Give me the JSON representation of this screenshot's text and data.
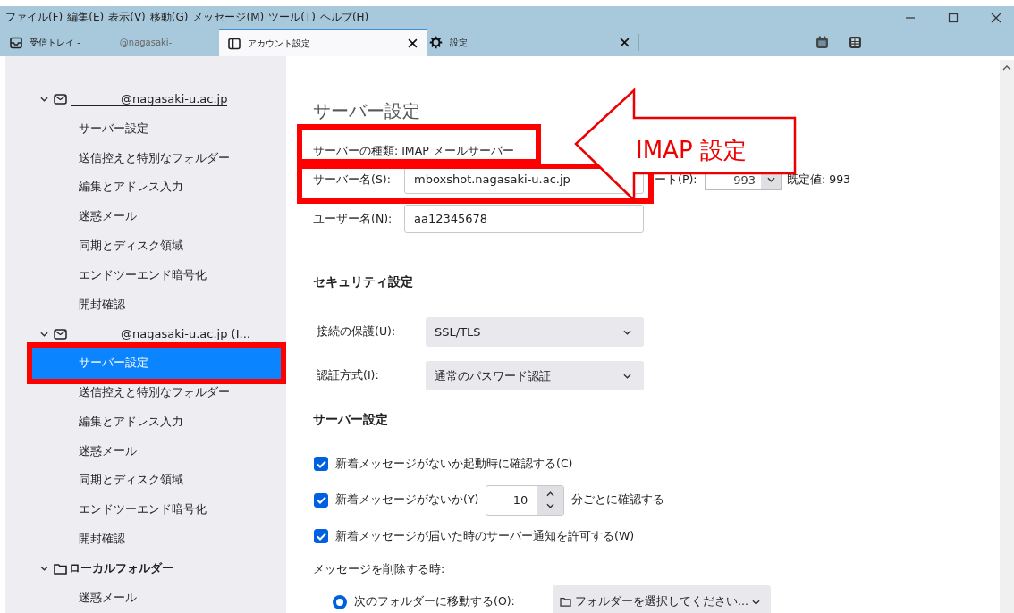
{
  "menu": [
    "ファイル(F)",
    "編集(E)",
    "表示(V)",
    "移動(G)",
    "メッセージ(M)",
    "ツール(T)",
    "ヘルプ(H)"
  ],
  "tabs": [
    {
      "kind": "mail",
      "label": "受信トレイ -",
      "sublabel": "@nagasaki-",
      "selected": false
    },
    {
      "kind": "account",
      "label": "アカウント設定",
      "selected": true,
      "closable": true
    },
    {
      "kind": "settings",
      "label": "設定",
      "selected": false,
      "closable": true
    }
  ],
  "sidebar": {
    "items": [
      {
        "kind": "account",
        "label": "@nagasaki-u.ac.jp",
        "underlined": true,
        "expanded": true,
        "children": [
          {
            "label": "サーバー設定",
            "selected": false
          },
          {
            "label": "送信控えと特別なフォルダー",
            "selected": false
          },
          {
            "label": "編集とアドレス入力",
            "selected": false
          },
          {
            "label": "迷惑メール",
            "selected": false
          },
          {
            "label": "同期とディスク領域",
            "selected": false
          },
          {
            "label": "エンドツーエンド暗号化",
            "selected": false
          },
          {
            "label": "開封確認",
            "selected": false
          }
        ]
      },
      {
        "kind": "account",
        "label": "@nagasaki-u.ac.jp (I...",
        "underlined": false,
        "expanded": true,
        "children": [
          {
            "label": "サーバー設定",
            "selected": true
          },
          {
            "label": "送信控えと特別なフォルダー",
            "selected": false
          },
          {
            "label": "編集とアドレス入力",
            "selected": false
          },
          {
            "label": "迷惑メール",
            "selected": false
          },
          {
            "label": "同期とディスク領域",
            "selected": false
          },
          {
            "label": "エンドツーエンド暗号化",
            "selected": false
          },
          {
            "label": "開封確認",
            "selected": false
          }
        ]
      },
      {
        "kind": "folder",
        "label": "ローカルフォルダー",
        "expanded": true,
        "children": [
          {
            "label": "迷惑メール",
            "selected": false
          }
        ]
      }
    ]
  },
  "page": {
    "title": "サーバー設定",
    "server_type": "サーバーの種類: IMAP メールサーバー",
    "server_name": {
      "label": "サーバー名(S):",
      "value": "mboxshot.nagasaki-u.ac.jp"
    },
    "port": {
      "label": "ート(P):",
      "value": "993",
      "default": "既定値: 993"
    },
    "user_name": {
      "label": "ユーザー名(N):",
      "value": "aa12345678"
    },
    "security": {
      "title": "セキュリティ設定",
      "selects": [
        {
          "label": "接続の保護(U):",
          "value": "SSL/TLS"
        },
        {
          "label": "認証方式(I):",
          "value": "通常のパスワード認証"
        }
      ]
    },
    "server": {
      "title": "サーバー設定",
      "checks": [
        {
          "kind": "plain",
          "label": "新着メッセージがないか起動時に確認する(C)",
          "checked": true
        },
        {
          "kind": "interval",
          "label": "新着メッセージがないか(Y)",
          "value": "10",
          "suffix": "分ごとに確認する",
          "checked": true
        },
        {
          "kind": "plain",
          "label": "新着メッセージが届いた時のサーバー通知を許可する(W)",
          "checked": true
        }
      ]
    },
    "delete": {
      "title": "メッセージを削除する時:",
      "radio": {
        "label": "次のフォルダーに移動する(O):",
        "selected": true
      },
      "folder": "フォルダーを選択してください..."
    }
  },
  "callout": {
    "text": "IMAP 設定"
  }
}
